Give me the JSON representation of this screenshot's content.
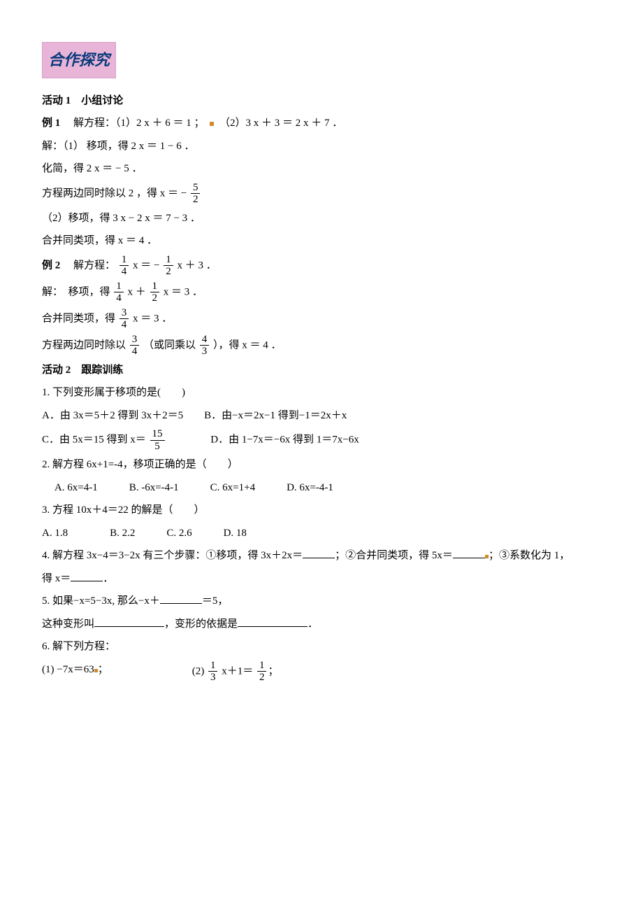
{
  "badge": "合作探究",
  "act1": {
    "title": "活动 1　小组讨论",
    "ex1_label": "例 1",
    "ex1_text": "　解方程：（1）2 x ＋ 6 ＝ 1 ；",
    "ex1_part2": "（2）3 x ＋ 3 ＝ 2 x ＋ 7 ．",
    "sol1_l1": "解：（1） 移项，得 2 x ＝ 1 − 6 ．",
    "sol1_l2": "化简，得 2 x ＝ − 5 ．",
    "sol1_l3_pre": "方程两边同时除以 2 ，得 x ＝ − ",
    "sol1_frac_num": "5",
    "sol1_frac_den": "2",
    "sol1_l4": "（2）移项，得 3 x − 2 x ＝ 7 − 3 ．",
    "sol1_l5": "合并同类项，得 x ＝ 4 ．",
    "ex2_label": "例 2",
    "ex2_pre": "　解方程：",
    "ex2_f1n": "1",
    "ex2_f1d": "4",
    "ex2_mid1": "x ＝ −",
    "ex2_f2n": "1",
    "ex2_f2d": "2",
    "ex2_tail": "x ＋ 3 ．",
    "sol2_l1_pre": "解：　移项，得",
    "sol2_f1n": "1",
    "sol2_f1d": "4",
    "sol2_mid": "x ＋",
    "sol2_f2n": "1",
    "sol2_f2d": "2",
    "sol2_tail": "x ＝ 3 ．",
    "sol2_l2_pre": "合并同类项，得",
    "sol2_l2_fn": "3",
    "sol2_l2_fd": "4",
    "sol2_l2_tail": " x ＝ 3 ．",
    "sol2_l3_pre": "方程两边同时除以",
    "sol2_l3_f1n": "3",
    "sol2_l3_f1d": "4",
    "sol2_l3_mid": "（或同乘以",
    "sol2_l3_f2n": "4",
    "sol2_l3_f2d": "3",
    "sol2_l3_tail": "），得 x ＝ 4 ．"
  },
  "act2": {
    "title": "活动 2　跟踪训练",
    "q1": "1. 下列变形属于移项的是(　　)",
    "q1_a": "A．由 3x＝5＋2 得到 3x＋2＝5　　B．由−x＝2x−1 得到−1＝2x＋x",
    "q1_c_pre": "C．由 5x＝15 得到 x＝",
    "q1_c_fn": "15",
    "q1_c_fd": "5",
    "q1_d": "　　　　D．由 1−7x＝−6x 得到 1＝7x−6x",
    "q2": "2. 解方程 6x+1=-4，移项正确的是（　　）",
    "q2_opts": "　 A. 6x=4-1　　　B. -6x=-4-1　　　C. 6x=1+4　　　D. 6x=-4-1",
    "q3": "3. 方程 10x＋4＝22 的解是（　　）",
    "q3_opts": "A. 1.8　　　　B. 2.2　　　C. 2.6　　　D. 18",
    "q4_a": "4. 解方程 3x−4＝3−2x 有三个步骤：①移项，得 3x＋2x＝",
    "q4_b": "；②合并同类项，得 5x＝",
    "q4_c": "；③系数化为 1，",
    "q4_d": "得 x＝",
    "q4_e": "．",
    "q5_a": "5. 如果−x=5−3x, 那么−x＋",
    "q5_b": "＝5，",
    "q5_c": "这种变形叫",
    "q5_d": "，变形的依据是",
    "q5_e": "．",
    "q6": "6. 解下列方程：",
    "q6_1": "(1) −7x＝63",
    "semi": "；",
    "q6_2_pre": "(2)",
    "q6_2_f1n": "1",
    "q6_2_f1d": "3",
    "q6_2_mid": "x＋1＝",
    "q6_2_f2n": "1",
    "q6_2_f2d": "2"
  }
}
